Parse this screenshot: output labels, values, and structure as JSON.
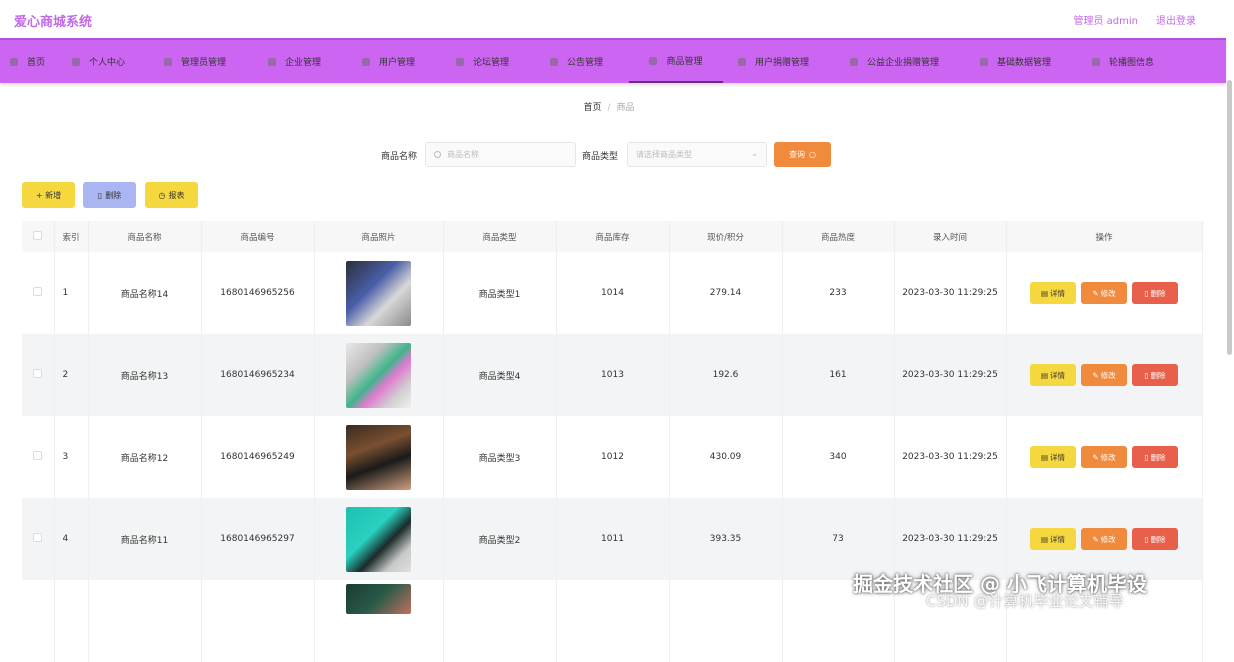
{
  "header": {
    "brand": "爱心商城系统",
    "admin_label": "管理员 admin",
    "logout_label": "退出登录"
  },
  "nav": [
    {
      "label": "首页"
    },
    {
      "label": "个人中心"
    },
    {
      "label": "管理员管理"
    },
    {
      "label": "企业管理"
    },
    {
      "label": "用户管理"
    },
    {
      "label": "论坛管理"
    },
    {
      "label": "公告管理"
    },
    {
      "label": "商品管理",
      "active": true
    },
    {
      "label": "用户捐赠管理"
    },
    {
      "label": "公益企业捐赠管理"
    },
    {
      "label": "基础数据管理"
    },
    {
      "label": "轮播图信息"
    }
  ],
  "breadcrumb": {
    "home": "首页",
    "sep": "/",
    "current": "商品"
  },
  "search": {
    "name_label": "商品名称",
    "name_placeholder": "商品名称",
    "type_label": "商品类型",
    "type_placeholder": "请选择商品类型",
    "query_label": "查询"
  },
  "actions": {
    "add_label": "+ 新增",
    "delete_label": "删除",
    "report_label": "报表"
  },
  "table": {
    "columns": [
      "索引",
      "商品名称",
      "商品编号",
      "商品照片",
      "商品类型",
      "商品库存",
      "现价/积分",
      "商品热度",
      "录入时间",
      "操作"
    ],
    "rows": [
      {
        "index": "1",
        "name": "商品名称14",
        "code": "1680146965256",
        "type": "商品类型1",
        "stock": "1014",
        "price": "279.14",
        "heat": "233",
        "time": "2023-03-30 11:29:25"
      },
      {
        "index": "2",
        "name": "商品名称13",
        "code": "1680146965234",
        "type": "商品类型4",
        "stock": "1013",
        "price": "192.6",
        "heat": "161",
        "time": "2023-03-30 11:29:25"
      },
      {
        "index": "3",
        "name": "商品名称12",
        "code": "1680146965249",
        "type": "商品类型3",
        "stock": "1012",
        "price": "430.09",
        "heat": "340",
        "time": "2023-03-30 11:29:25"
      },
      {
        "index": "4",
        "name": "商品名称11",
        "code": "1680146965297",
        "type": "商品类型2",
        "stock": "1011",
        "price": "393.35",
        "heat": "73",
        "time": "2023-03-30 11:29:25"
      }
    ],
    "op_detail": "详情",
    "op_edit": "修改",
    "op_delete": "删除"
  },
  "watermark": {
    "line1": "掘金技术社区 @ 小飞计算机毕设",
    "line2": "CSDN @计算机毕业论文辅导"
  }
}
